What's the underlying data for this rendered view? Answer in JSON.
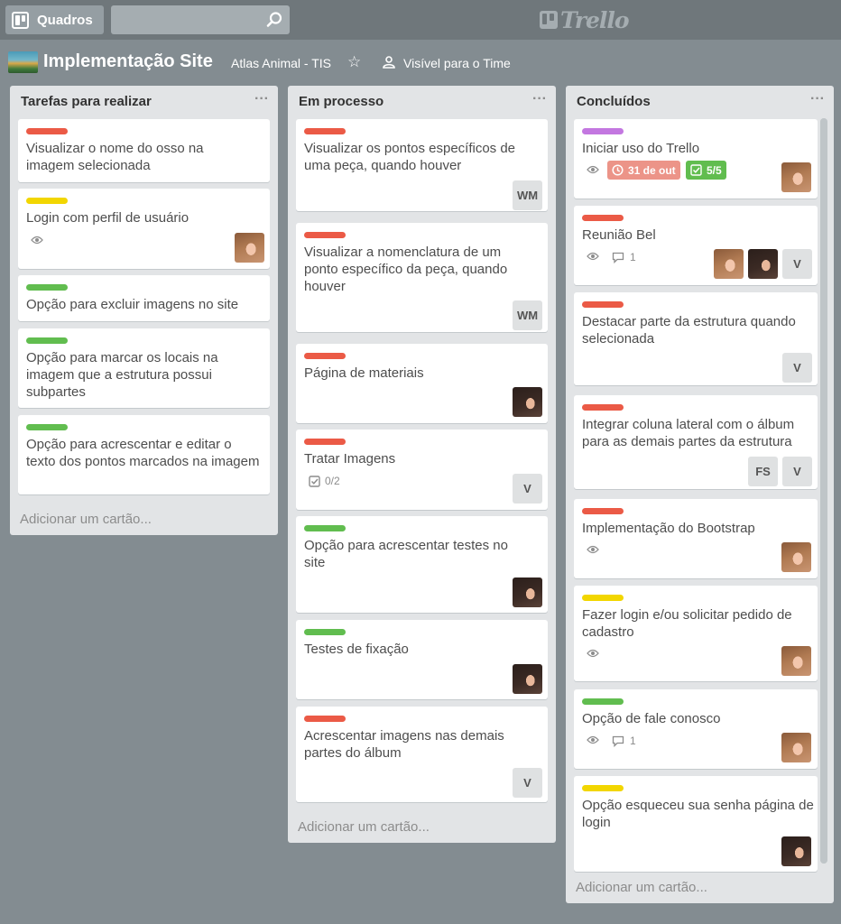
{
  "header": {
    "boards_label": "Quadros",
    "search_value": "",
    "logo_text": "Trello"
  },
  "board": {
    "title": "Implementação Site",
    "team": "Atlas Animal - TIS",
    "visibility": "Visível para o Time"
  },
  "colors": {
    "red": "#eb5a46",
    "yellow": "#f2d600",
    "green": "#61bd4f",
    "purple": "#c377e0",
    "due_soon": "#ec9488"
  },
  "lists": [
    {
      "title": "Tarefas para realizar",
      "menu": "···",
      "add_card": "Adicionar um cartão...",
      "cards": [
        {
          "label": "red",
          "title": "Visualizar o nome do osso na imagem selecionada"
        },
        {
          "label": "yellow",
          "title": "Login com perfil de usuário",
          "watch": true,
          "member": "avatar-a"
        },
        {
          "label": "green",
          "title": "Opção para excluir imagens no site"
        },
        {
          "label": "green",
          "title": "Opção para marcar os locais na imagem que a estrutura possui subpartes"
        },
        {
          "label": "green",
          "title": "Opção para acrescentar e editar o texto dos pontos marcados na imagem"
        }
      ]
    },
    {
      "title": "Em processo",
      "menu": "···",
      "add_card": "Adicionar um cartão...",
      "cards": [
        {
          "label": "red",
          "title": "Visualizar os pontos específicos de uma peça, quando houver",
          "initials": "WM"
        },
        {
          "label": "red",
          "title": "Visualizar a nomenclatura de um ponto específico da peça, quando houver",
          "initials": "WM"
        },
        {
          "label": "red",
          "title": "Página de materiais",
          "member": "avatar-b"
        },
        {
          "label": "red",
          "title": "Tratar Imagens",
          "checklist": "0/2",
          "initials": "V"
        },
        {
          "label": "green",
          "title": "Opção para acrescentar testes no site",
          "member": "avatar-b"
        },
        {
          "label": "green",
          "title": "Testes de fixação",
          "member": "avatar-b"
        },
        {
          "label": "red",
          "title": "Acrescentar imagens nas demais partes do álbum",
          "initials": "V"
        }
      ]
    },
    {
      "title": "Concluídos",
      "menu": "···",
      "add_card": "Adicionar um cartão...",
      "cards": [
        {
          "label": "purple",
          "title": "Iniciar uso do Trello",
          "watch": true,
          "due": "31 de out",
          "checklist": "5/5",
          "member": "avatar-a"
        },
        {
          "label": "red",
          "title": "Reunião Bel",
          "watch": true,
          "comments": "1",
          "initials": "V"
        },
        {
          "label": "red",
          "title": "Destacar parte da estrutura quando selecionada",
          "initials": "V"
        },
        {
          "label": "red",
          "title": "Integrar coluna lateral com o álbum para as demais partes da estrutura",
          "initials": [
            "FS",
            "V"
          ]
        },
        {
          "label": "red",
          "title": "Implementação do Bootstrap",
          "watch": true,
          "member": "avatar-a"
        },
        {
          "label": "yellow",
          "title": "Fazer login e/ou solicitar pedido de cadastro",
          "watch": true,
          "member": "avatar-a"
        },
        {
          "label": "green",
          "title": "Opção de fale conosco",
          "watch": true,
          "comments": "1",
          "member": "avatar-a"
        },
        {
          "label": "yellow",
          "title": "Opção esqueceu sua senha página de login",
          "member": "avatar-b"
        }
      ]
    }
  ]
}
